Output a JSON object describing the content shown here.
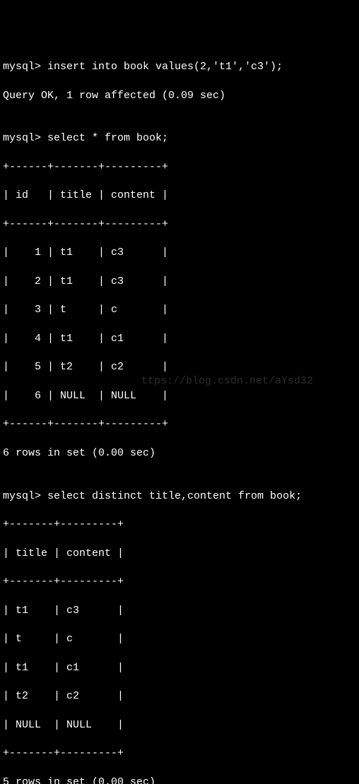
{
  "line1": "mysql> insert into book values(2,'t1','c3');",
  "line2": "Query OK, 1 row affected (0.09 sec)",
  "blank": "",
  "line3": "mysql> select * from book;",
  "t1_border": "+------+-------+---------+",
  "t1_header": "| id   | title | content |",
  "t1_rows": [
    "|    1 | t1    | c3      |",
    "|    2 | t1    | c3      |",
    "|    3 | t     | c       |",
    "|    4 | t1    | c1      |",
    "|    5 | t2    | c2      |",
    "|    6 | NULL  | NULL    |"
  ],
  "t1_footer": "6 rows in set (0.00 sec)",
  "line4": "mysql> select distinct title,content from book;",
  "t2_border": "+-------+---------+",
  "t2_header": "| title | content |",
  "t2_rows": [
    "| t1    | c3      |",
    "| t     | c       |",
    "| t1    | c1      |",
    "| t2    | c2      |",
    "| NULL  | NULL    |"
  ],
  "t2_footer": "5 rows in set (0.00 sec)",
  "watermark": "ttps://blog.csdn.net/aYsd32"
}
